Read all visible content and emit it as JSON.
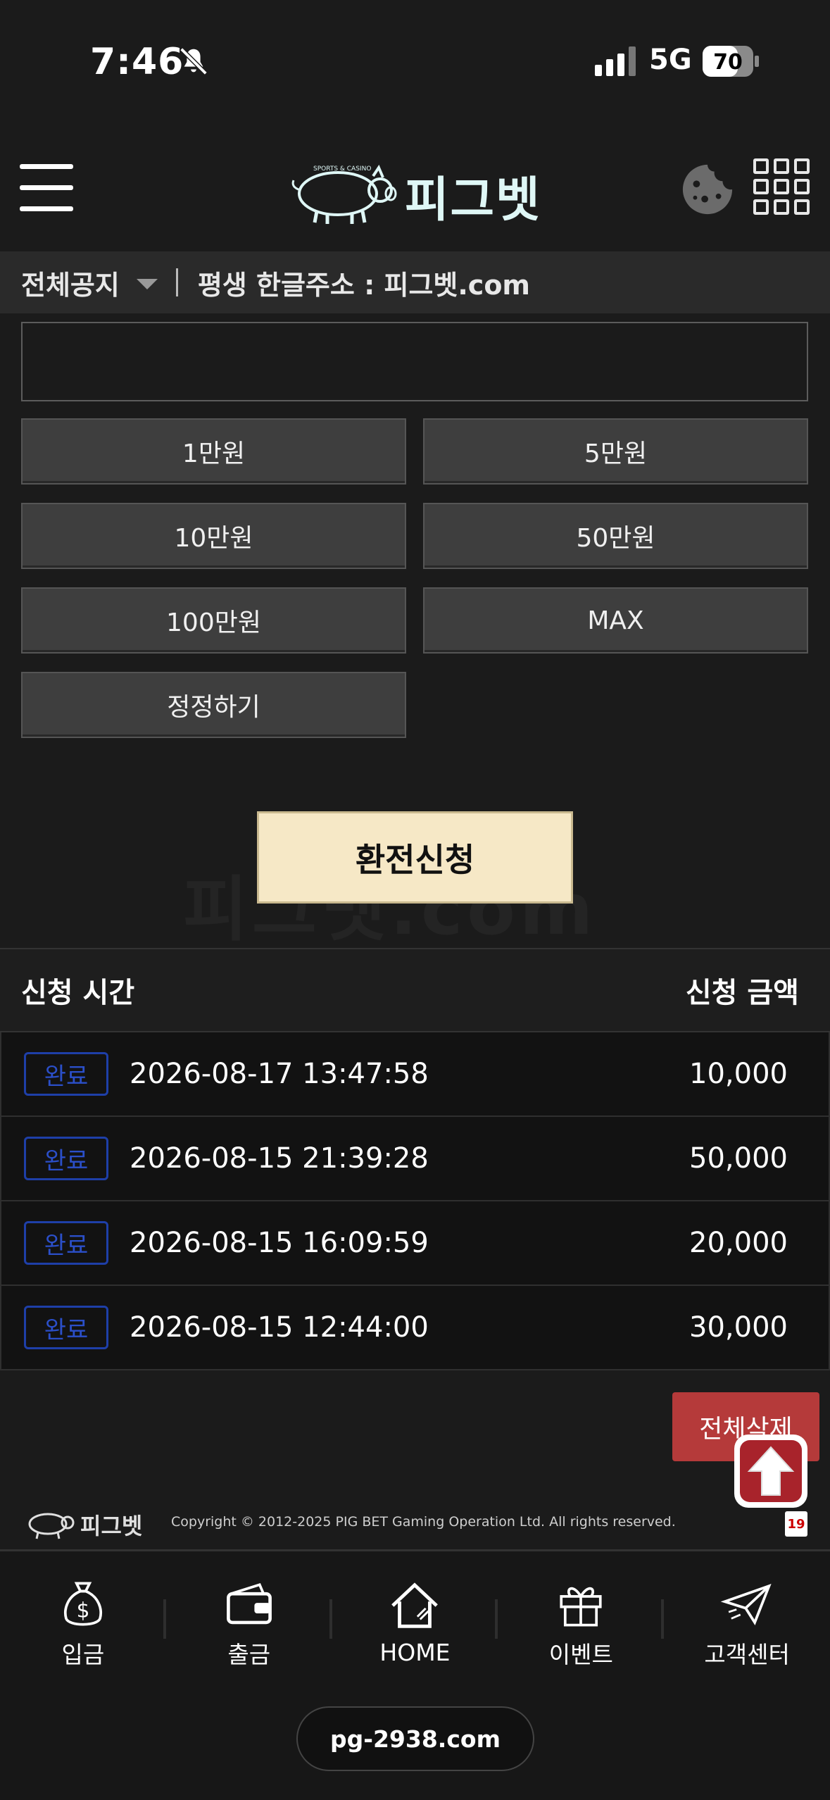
{
  "status": {
    "time": "7:46",
    "network": "5G",
    "battery": "70"
  },
  "header": {
    "brand": "피그벳",
    "brand_sub": "SPORTS & CASINO"
  },
  "notice": {
    "label": "전체공지",
    "text": "평생 한글주소 : 피그벳.com"
  },
  "form": {
    "amount_value": "",
    "quick_buttons": [
      "1만원",
      "5만원",
      "10만원",
      "50만원",
      "100만원",
      "MAX",
      "정정하기"
    ],
    "submit_label": "환전신청",
    "watermark": "피그벳.com"
  },
  "history": {
    "columns": [
      "신청 시간",
      "신청 금액"
    ],
    "rows": [
      {
        "status": "완료",
        "time": "2026-08-17 13:47:58",
        "amount": "10,000"
      },
      {
        "status": "완료",
        "time": "2026-08-15 21:39:28",
        "amount": "50,000"
      },
      {
        "status": "완료",
        "time": "2026-08-15 16:09:59",
        "amount": "20,000"
      },
      {
        "status": "완료",
        "time": "2026-08-15 12:44:00",
        "amount": "30,000"
      }
    ],
    "delete_all_label": "전체삭제"
  },
  "footer": {
    "brand": "피그벳",
    "copyright": "Copyright © 2012-2025 PIG BET Gaming Operation Ltd. All rights reserved.",
    "age_badge": "19"
  },
  "bottom_nav": {
    "items": [
      {
        "label": "입금",
        "icon": "money-bag-icon"
      },
      {
        "label": "출금",
        "icon": "wallet-icon"
      },
      {
        "label": "HOME",
        "icon": "home-icon"
      },
      {
        "label": "이벤트",
        "icon": "gift-icon"
      },
      {
        "label": "고객센터",
        "icon": "paper-plane-icon"
      }
    ],
    "url": "pg-2938.com"
  },
  "colors": {
    "background": "#1b1b1b",
    "submit": "#f6e8c6",
    "badge": "#2b4fc9",
    "delete": "#b53a3a",
    "brand": "#dff7f6"
  }
}
